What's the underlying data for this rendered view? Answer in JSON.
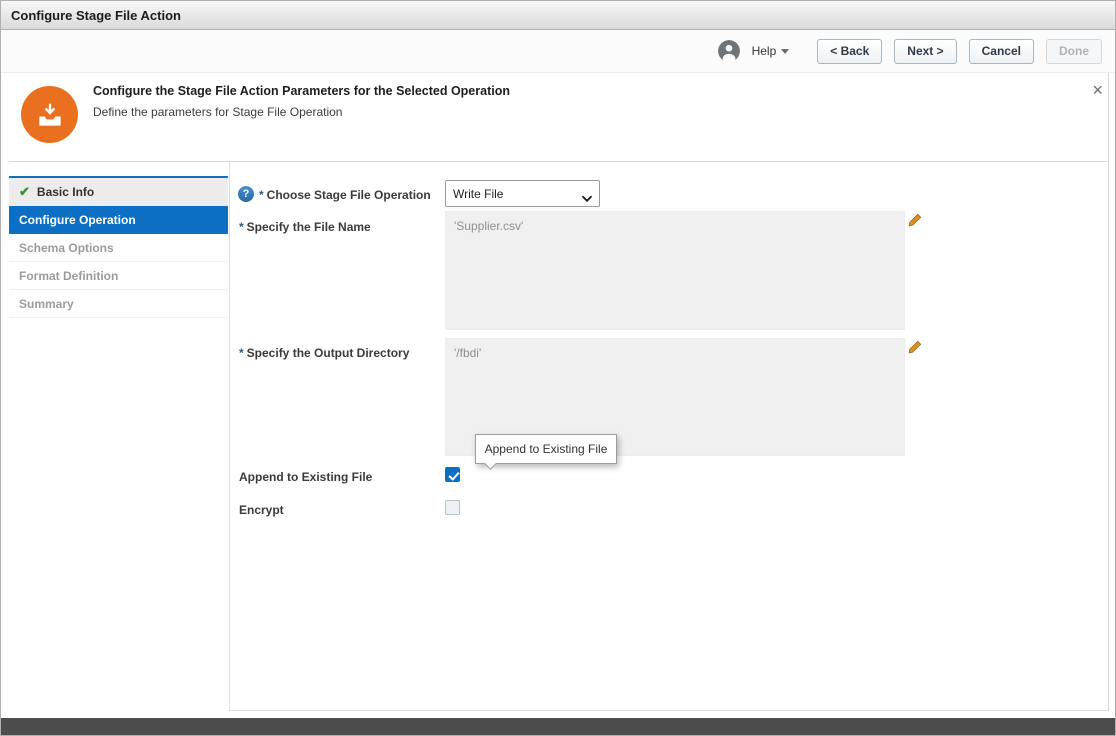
{
  "window": {
    "title": "Configure Stage File Action"
  },
  "toolbar": {
    "help_label": "Help",
    "back_label": "< Back",
    "next_label": "Next >",
    "cancel_label": "Cancel",
    "done_label": "Done"
  },
  "header": {
    "title": "Configure the Stage File Action Parameters for the Selected Operation",
    "subtitle": "Define the parameters for Stage File Operation"
  },
  "sidebar": {
    "items": [
      {
        "label": "Basic Info",
        "state": "completed"
      },
      {
        "label": "Configure Operation",
        "state": "active"
      },
      {
        "label": "Schema Options",
        "state": "upcoming"
      },
      {
        "label": "Format Definition",
        "state": "upcoming"
      },
      {
        "label": "Summary",
        "state": "upcoming"
      }
    ]
  },
  "form": {
    "required_marker": "*",
    "operation": {
      "label": "Choose Stage File Operation",
      "value": "Write File"
    },
    "file_name": {
      "label": "Specify the File Name",
      "value": "'Supplier.csv'"
    },
    "output_directory": {
      "label": "Specify the Output Directory",
      "value": "'/fbdi'"
    },
    "append_to_existing": {
      "label": "Append to Existing File",
      "checked": true
    },
    "encrypt": {
      "label": "Encrypt",
      "checked": false
    },
    "tooltip_text": "Append to Existing File"
  },
  "icons": {
    "help_glyph": "?",
    "check_glyph": "✔",
    "close_glyph": "×"
  },
  "colors": {
    "accent_blue": "#0C6FC4",
    "brand_orange": "#E9701E",
    "success_green": "#3D8F3D",
    "footer_gray": "#4C4C4C"
  }
}
